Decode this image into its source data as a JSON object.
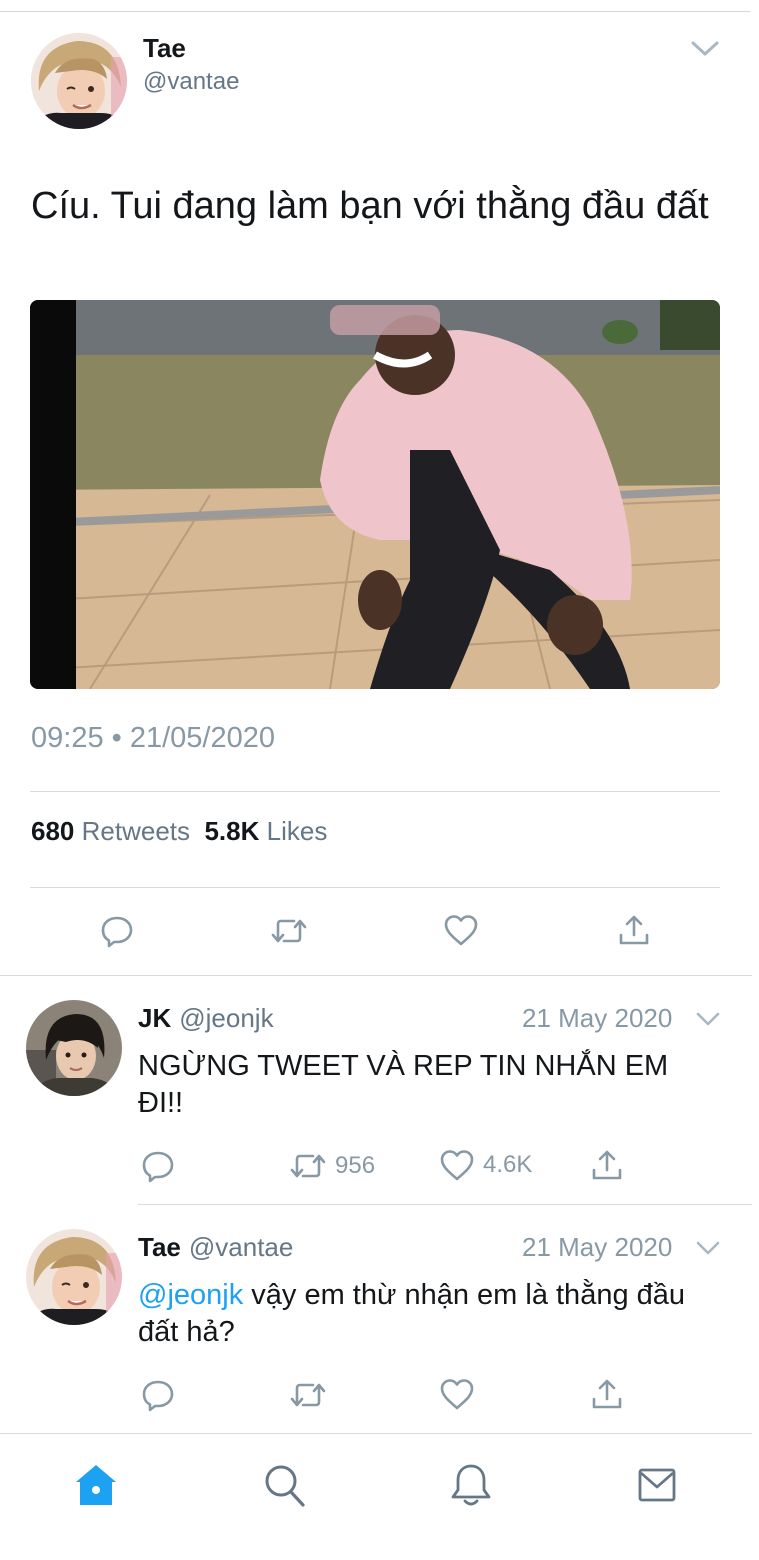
{
  "tweet": {
    "author_name": "Tae",
    "author_handle": "@vantae",
    "text": "Cíu. Tui đang làm bạn với thằng đầu đất",
    "timestamp": "09:25 • 21/05/2020",
    "retweets_count": "680",
    "retweets_label": "Retweets",
    "likes_count": "5.8K",
    "likes_label": "Likes"
  },
  "replies": [
    {
      "name": "JK",
      "handle": "@jeonjk",
      "date": "21 May 2020",
      "text": "NGỪNG TWEET VÀ REP TIN NHẮN EM ĐI!!",
      "retweets": "956",
      "likes": "4.6K"
    },
    {
      "name": "Tae",
      "handle": "@vantae",
      "date": "21 May 2020",
      "mention": "@jeonjk",
      "text": " vậy em thừ nhận em là thằng đầu đất hả?"
    }
  ],
  "nav": {
    "items": [
      "home-icon",
      "search-icon",
      "bell-icon",
      "mail-icon"
    ],
    "active": "home"
  },
  "colors": {
    "accent": "#1da1f2",
    "secondary_text": "#657786",
    "icon_gray": "#8899a6"
  }
}
